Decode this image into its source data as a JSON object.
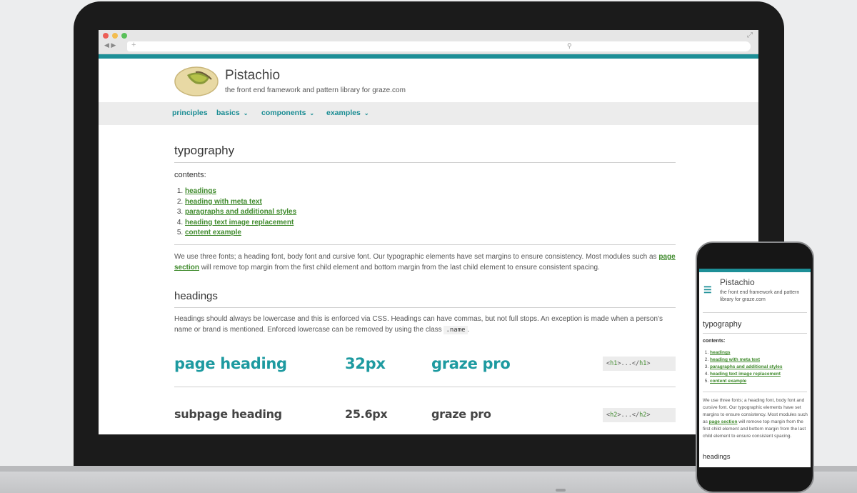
{
  "site": {
    "title": "Pistachio",
    "subtitle": "the front end framework and pattern library for graze.com"
  },
  "nav": {
    "items": [
      "principles",
      "basics",
      "components",
      "examples"
    ]
  },
  "page": {
    "title": "typography",
    "contents_label": "contents:",
    "toc": [
      "headings",
      "heading with meta text",
      "paragraphs and additional styles",
      "heading text image replacement",
      "content example"
    ],
    "intro_text": "We use three fonts; a heading font, body font and cursive font. Our typographic elements have set margins to ensure consistency. Most modules such as",
    "intro_link": "page section",
    "intro_text_end": "will remove top margin from the first child element and bottom margin from the last child element to ensure consistent spacing.",
    "headings_title": "headings",
    "headings_text": "Headings should always be lowercase and this is enforced via CSS. Headings can have commas, but not full stops. An exception is made when a person's name or brand is mentioned. Enforced lowercase can be removed by using the class",
    "headings_code": ".name",
    "headings_text_end": ".",
    "rows": [
      {
        "name": "page heading",
        "size": "32px",
        "font": "graze pro",
        "tag_open": "h1",
        "tag_close": "h1"
      },
      {
        "name": "subpage heading",
        "size": "25.6px",
        "font": "graze pro",
        "tag_open": "h2",
        "tag_close": "h2"
      }
    ]
  },
  "mobile": {
    "title": "Pistachio",
    "subtitle": "the front end framework and pattern library for graze.com",
    "page_title": "typography",
    "contents_label": "contents:",
    "toc": [
      "headings",
      "heading with meta text",
      "paragraphs and additional styles",
      "heading text image replacement",
      "content example"
    ],
    "intro_text": "We use three fonts; a heading font, body font and cursive font. Our typographic elements have set margins to ensure consistency. Most modules such as",
    "intro_link": "page section",
    "intro_text_end": "will remove top margin from the first child element and bottom margin from the last child element to ensure consistent spacing.",
    "headings_title": "headings"
  },
  "icons": {
    "menu": "hamburger-icon",
    "logo": "pistachio-logo"
  },
  "colors": {
    "teal": "#1d8f97",
    "link_green": "#3f8a2c",
    "heading_teal": "#1d9aa0"
  }
}
